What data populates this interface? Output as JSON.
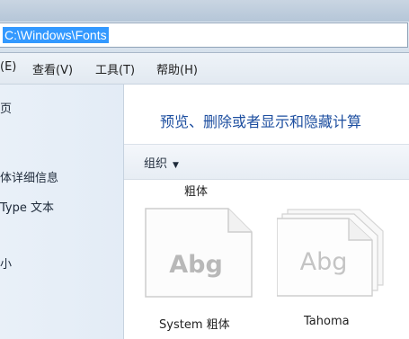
{
  "address": {
    "path": "C:\\Windows\\Fonts"
  },
  "menu": [
    {
      "label": "(E)"
    },
    {
      "label": "查看(V)"
    },
    {
      "label": "工具(T)"
    },
    {
      "label": "帮助(H)"
    }
  ],
  "nav": [
    {
      "label": "页"
    },
    {
      "label": "体详细信息"
    },
    {
      "label": "Type 文本"
    },
    {
      "label": "小"
    }
  ],
  "main": {
    "heading": "预览、删除或者显示和隐藏计算",
    "organize_label": "组织",
    "organize_arrow": "▼",
    "top_caption": "粗体"
  },
  "fonts": [
    {
      "preview": "Abg",
      "name": "System 粗体",
      "preview_color": "#b8b8b8",
      "bold": true
    },
    {
      "preview": "Abg",
      "name": "Tahoma",
      "preview_color": "#c4c4c4",
      "bold": false
    }
  ]
}
